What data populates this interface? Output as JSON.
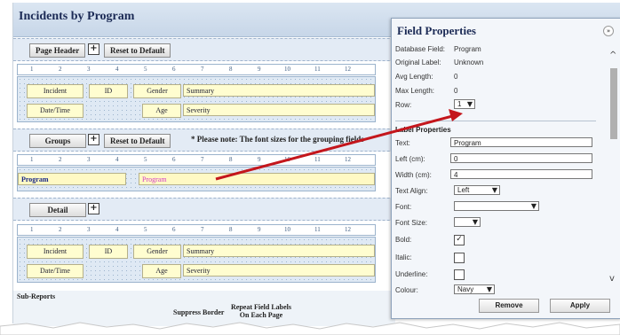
{
  "title": "Incidents by Program",
  "page_header": {
    "button": "Page Header",
    "expand_icon": "plus-box-icon",
    "reset_button": "Reset to Default",
    "ruler": [
      "1",
      "2",
      "3",
      "4",
      "5",
      "6",
      "7",
      "8",
      "9",
      "10",
      "11",
      "12"
    ],
    "row1": [
      "Incident",
      "ID",
      "Gender",
      "Summary"
    ],
    "row2": [
      "Date/Time",
      "Age",
      "Severity"
    ]
  },
  "groups": {
    "button": "Groups",
    "reset_button": "Reset to Default",
    "note": "* Please note: The font sizes for the grouping fields",
    "row": [
      "Program",
      "Program"
    ]
  },
  "detail": {
    "button": "Detail",
    "row1": [
      "Incident",
      "ID",
      "Gender",
      "Summary"
    ],
    "row2": [
      "Date/Time",
      "Age",
      "Severity"
    ]
  },
  "sub_reports": {
    "heading": "Sub-Reports",
    "col1": "Suppress Border",
    "col2_line1": "Repeat Field Labels",
    "col2_line2": "On Each Page"
  },
  "panel": {
    "title": "Field Properties",
    "collapse_icon": "double-chevron-icon",
    "database_field_label": "Database Field:",
    "database_field_value": "Program",
    "original_label_label": "Original Label:",
    "original_label_value": "Unknown",
    "avg_length_label": "Avg Length:",
    "avg_length_value": "0",
    "max_length_label": "Max Length:",
    "max_length_value": "0",
    "row_label": "Row:",
    "row_value": "1",
    "label_properties": "Label Properties",
    "text_label": "Text:",
    "text_value": "Program",
    "left_label": "Left (cm):",
    "left_value": "0",
    "width_label": "Width (cm):",
    "width_value": "4",
    "text_align_label": "Text Align:",
    "text_align_value": "Left",
    "font_label": "Font:",
    "font_value": "",
    "font_size_label": "Font Size:",
    "font_size_value": "",
    "bold_label": "Bold:",
    "bold_checked": "✓",
    "italic_label": "Italic:",
    "underline_label": "Underline:",
    "colour_label": "Colour:",
    "colour_value": "Navy",
    "remove_button": "Remove",
    "apply_button": "Apply"
  },
  "colors": {
    "arrow": "#c4161c",
    "program_group_text": "#1b2a88",
    "program_field_text": "#d43ec7"
  }
}
